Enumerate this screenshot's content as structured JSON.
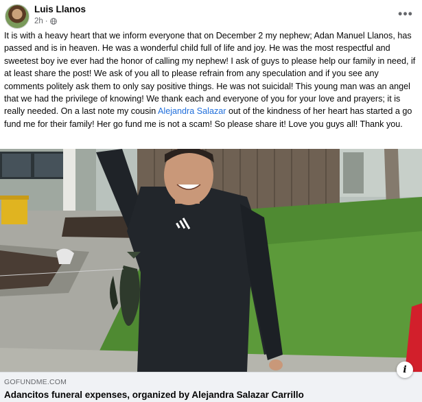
{
  "post": {
    "author": "Luis Llanos",
    "time": "2h",
    "separator": "·",
    "more_glyph": "•••",
    "privacy_icon": "globe-icon",
    "text_part1": "It is with a heavy heart that we inform everyone that on December 2 my nephew; Adan Manuel Llanos, has passed and is in heaven. He was a wonderful child full of life and joy. He was the most respectful and sweetest boy ive ever had the honor of calling my nephew! I ask of guys to please help our family in need, if at least share the post! We ask of you all to please refrain from any speculation and if you see any comments politely ask them to only say positive things. He was not suicidal! This young man was an angel that we had the privilege of knowing! We thank each and everyone of you for your love and prayers; it is really needed. On a last note my cousin ",
    "mention": "Alejandra Salazar",
    "text_part2": " out of the kindness of her heart has started a go fund me for their family! Her go fund me is not a scam! So please share it! Love you guys all! Thank you."
  },
  "link_preview": {
    "domain": "GOFUNDME.COM",
    "title": "Adancitos funeral expenses, organized by Alejandra Salazar Carrillo",
    "info_glyph": "i"
  },
  "colors": {
    "mention": "#216fdb",
    "secondary_text": "#65676b",
    "footer_bg": "#f0f2f5"
  }
}
